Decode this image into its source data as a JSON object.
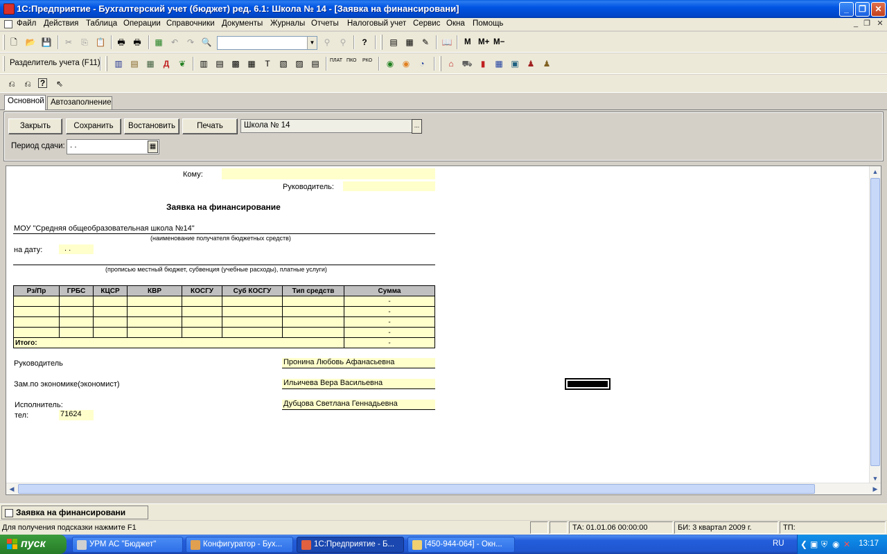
{
  "window": {
    "title": "1С:Предприятие - Бухгалтерский учет (бюджет) ред. 6.1:  Школа № 14 - [Заявка на финансировани]"
  },
  "menu": [
    "Файл",
    "Действия",
    "Таблица",
    "Операции",
    "Справочники",
    "Документы",
    "Журналы",
    "Отчеты",
    "Налоговый учет",
    "Сервис",
    "Окна",
    "Помощь"
  ],
  "toolbar": {
    "memory_buttons": [
      "M",
      "M+",
      "M−"
    ],
    "divider_label": "Разделитель учета (F11)",
    "payment_labels": [
      "ПЛАТ",
      "ПКО",
      "РКО"
    ]
  },
  "tabs": [
    "Основной",
    "Автозаполнение"
  ],
  "form": {
    "buttons": {
      "close": "Закрыть",
      "save": "Сохранить",
      "restore": "Востановить",
      "print": "Печать"
    },
    "organization_value": "Школа № 14",
    "select_button": "...",
    "period_label": "Период сдачи:",
    "period_value": " .  ."
  },
  "document": {
    "to_label": "Кому:",
    "head_label": "Руководитель:",
    "title": "Заявка на финансирование",
    "recipient": "МОУ \"Средняя общеобразовательная школа №14\"",
    "recipient_caption": "(наименование получателя бюджетных средств)",
    "date_label": "на дату:",
    "date_value": ". .",
    "source_caption": "(прописью местный бюджет, субвенция (учебные расходы), платные услуги)",
    "table": {
      "headers": [
        "Рз/Пр",
        "ГРБС",
        "КЦСР",
        "КВР",
        "КОСГУ",
        "Суб КОСГУ",
        "Тип средств",
        "Сумма"
      ],
      "rows": [
        [
          "",
          "",
          "",
          "",
          "",
          "",
          "",
          "-"
        ],
        [
          "",
          "",
          "",
          "",
          "",
          "",
          "",
          "-"
        ],
        [
          "",
          "",
          "",
          "",
          "",
          "",
          "",
          "-"
        ],
        [
          "",
          "",
          "",
          "",
          "",
          "",
          "",
          "-"
        ]
      ],
      "total_label": "Итого:",
      "total_value": "-"
    },
    "signatures": [
      {
        "role": "Руководитель",
        "name": "Пронина Любовь Афанасьевна"
      },
      {
        "role": "Зам.по экономике(экономист)",
        "name": "Ильичева Вера Васильевна"
      },
      {
        "role": "Исполнитель:",
        "name": "Дубцова Светлана Геннадьевна"
      }
    ],
    "phone_label": "тел:",
    "phone_value": "71624"
  },
  "window_tab": "Заявка на финансировани",
  "status": {
    "hint": "Для получения подсказки нажмите F1",
    "ta": "ТА: 01.01.06  00:00:00",
    "bi": "БИ: 3 квартал 2009 г.",
    "tp": "ТП:"
  },
  "taskbar": {
    "start": "пуск",
    "items": [
      "УРМ АС \"Бюджет\"",
      "Конфигуратор - Бух...",
      "1С:Предприятие - Б...",
      "[450-944-064] - Окн..."
    ],
    "lang": "RU",
    "clock": "13:17"
  }
}
